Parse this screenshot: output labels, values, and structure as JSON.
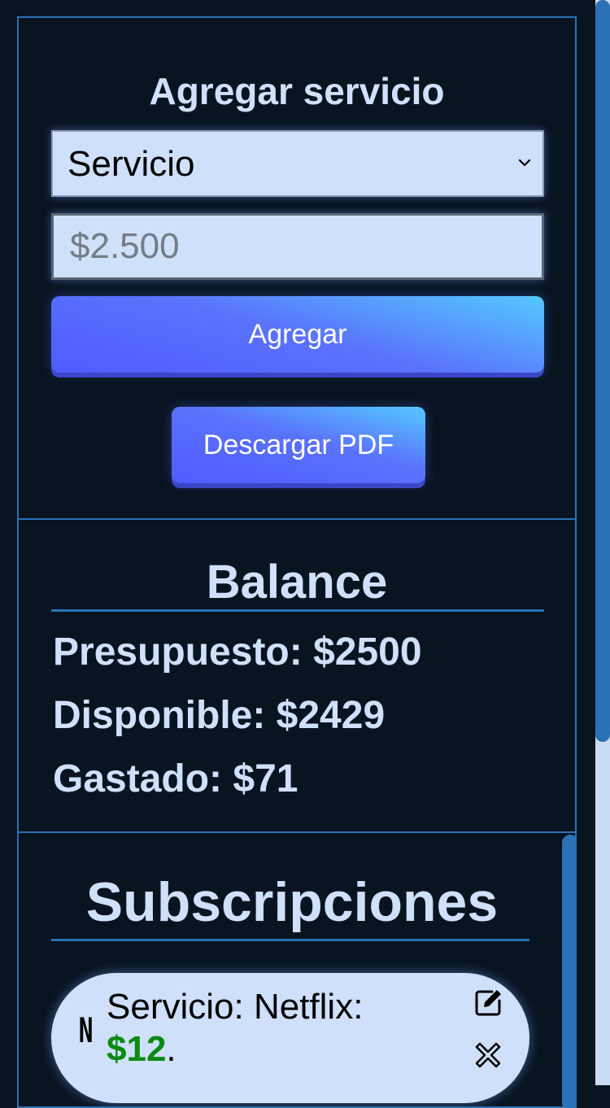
{
  "add_section": {
    "title": "Agregar servicio",
    "select_value": "Servicio",
    "amount_placeholder": "$2.500",
    "add_button": "Agregar",
    "pdf_button": "Descargar PDF"
  },
  "balance": {
    "title": "Balance",
    "budget": "Presupuesto: $2500",
    "available": "Disponible: $2429",
    "spent": "Gastado: $71"
  },
  "subscriptions": {
    "title": "Subscripciones",
    "items": [
      {
        "logo": "N",
        "label": "Servicio: Netflix:",
        "amount": "$12",
        "suffix": ".",
        "edit_icon": "edit-icon",
        "delete_icon": "close-icon"
      }
    ]
  },
  "colors": {
    "background": "#081420",
    "accent": "#2a72b5",
    "text": "#cfe0fb",
    "amount": "#0a8a12"
  }
}
